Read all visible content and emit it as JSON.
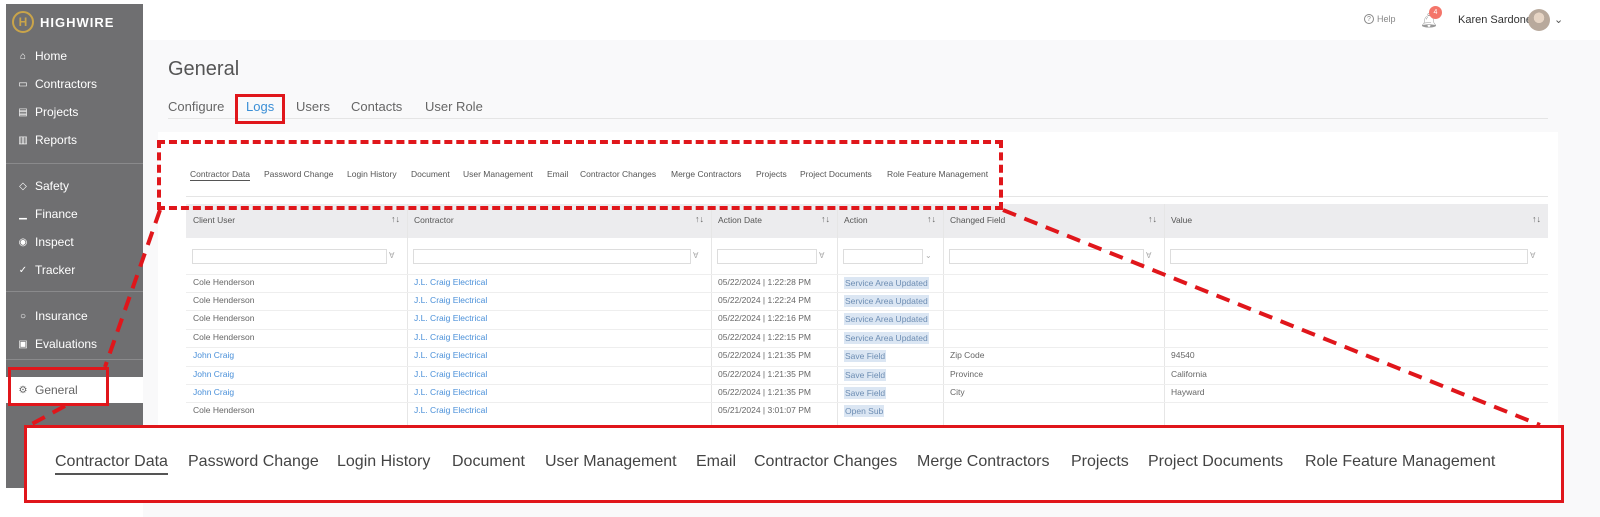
{
  "brand": {
    "logo_letter": "H",
    "name": "HIGHWIRE"
  },
  "sidebar": {
    "items": [
      {
        "label": "Home",
        "icon": "home-icon",
        "glyph": "⌂"
      },
      {
        "label": "Contractors",
        "icon": "contractors-icon",
        "glyph": "▭"
      },
      {
        "label": "Projects",
        "icon": "projects-icon",
        "glyph": "▤"
      },
      {
        "label": "Reports",
        "icon": "reports-icon",
        "glyph": "▥"
      },
      {
        "label": "Safety",
        "icon": "shield-icon",
        "glyph": "◇"
      },
      {
        "label": "Finance",
        "icon": "finance-icon",
        "glyph": "▁"
      },
      {
        "label": "Inspect",
        "icon": "eye-icon",
        "glyph": "◉"
      },
      {
        "label": "Tracker",
        "icon": "tracker-icon",
        "glyph": "✓"
      },
      {
        "label": "Insurance",
        "icon": "insurance-icon",
        "glyph": "○"
      },
      {
        "label": "Evaluations",
        "icon": "evaluations-icon",
        "glyph": "▣"
      },
      {
        "label": "General",
        "icon": "gear-icon",
        "glyph": "⚙"
      }
    ]
  },
  "header": {
    "help_label": "Help",
    "notification_count": "4",
    "user_name": "Karen Sardone"
  },
  "page": {
    "title": "General",
    "tabs": [
      "Configure",
      "Logs",
      "Users",
      "Contacts",
      "User Role"
    ],
    "active_tab": "Logs"
  },
  "subtabs": [
    "Contractor Data",
    "Password Change",
    "Login History",
    "Document",
    "User Management",
    "Email",
    "Contractor Changes",
    "Merge Contractors",
    "Projects",
    "Project Documents",
    "Role Feature Management"
  ],
  "table": {
    "columns": [
      "Client User",
      "Contractor",
      "Action Date",
      "Action",
      "Changed Field",
      "Value"
    ],
    "rows": [
      [
        "Cole Henderson",
        "J.L. Craig Electrical",
        "05/22/2024 | 1:22:28 PM",
        "Service Area Updated",
        "",
        ""
      ],
      [
        "Cole Henderson",
        "J.L. Craig Electrical",
        "05/22/2024 | 1:22:24 PM",
        "Service Area Updated",
        "",
        ""
      ],
      [
        "Cole Henderson",
        "J.L. Craig Electrical",
        "05/22/2024 | 1:22:16 PM",
        "Service Area Updated",
        "",
        ""
      ],
      [
        "Cole Henderson",
        "J.L. Craig Electrical",
        "05/22/2024 | 1:22:15 PM",
        "Service Area Updated",
        "",
        ""
      ],
      [
        "John Craig",
        "J.L. Craig Electrical",
        "05/22/2024 | 1:21:35 PM",
        "Save Field",
        "Zip Code",
        "94540"
      ],
      [
        "John Craig",
        "J.L. Craig Electrical",
        "05/22/2024 | 1:21:35 PM",
        "Save Field",
        "Province",
        "California"
      ],
      [
        "John Craig",
        "J.L. Craig Electrical",
        "05/22/2024 | 1:21:35 PM",
        "Save Field",
        "City",
        "Hayward"
      ],
      [
        "Cole Henderson",
        "J.L. Craig Electrical",
        "05/21/2024 | 3:01:07 PM",
        "Open Sub",
        "",
        ""
      ]
    ]
  },
  "colors": {
    "accent": "#3b8fd6",
    "callout": "#e0161b",
    "sidebar": "#6f6f71"
  }
}
